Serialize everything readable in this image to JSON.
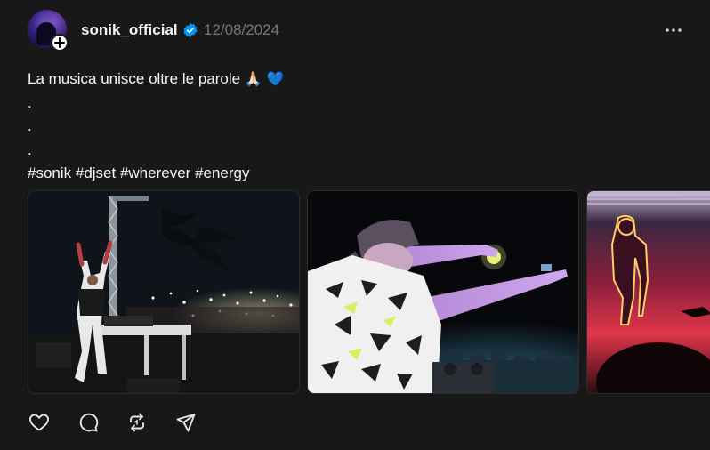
{
  "post": {
    "username": "sonik_official",
    "timestamp": "12/08/2024",
    "verified": true,
    "caption_lines": [
      "La musica unisce oltre le parole",
      ".",
      ".",
      ".",
      "#sonik #djset #wherever #energy"
    ],
    "caption_emojis": [
      "🙏🏻",
      "💙"
    ],
    "media": [
      {
        "description_icon": "photo-dj-stage-crowd"
      },
      {
        "description_icon": "photo-dj-pointing-crowd"
      },
      {
        "description_icon": "photo-neon-figure-stage"
      }
    ],
    "actions": [
      "like-icon",
      "comment-icon",
      "repost-icon",
      "share-icon"
    ]
  },
  "colors": {
    "background": "#181818",
    "text": "#f3f5f7",
    "muted": "#777777",
    "verified": "#0095f6",
    "heart": "#2f8cf5"
  }
}
